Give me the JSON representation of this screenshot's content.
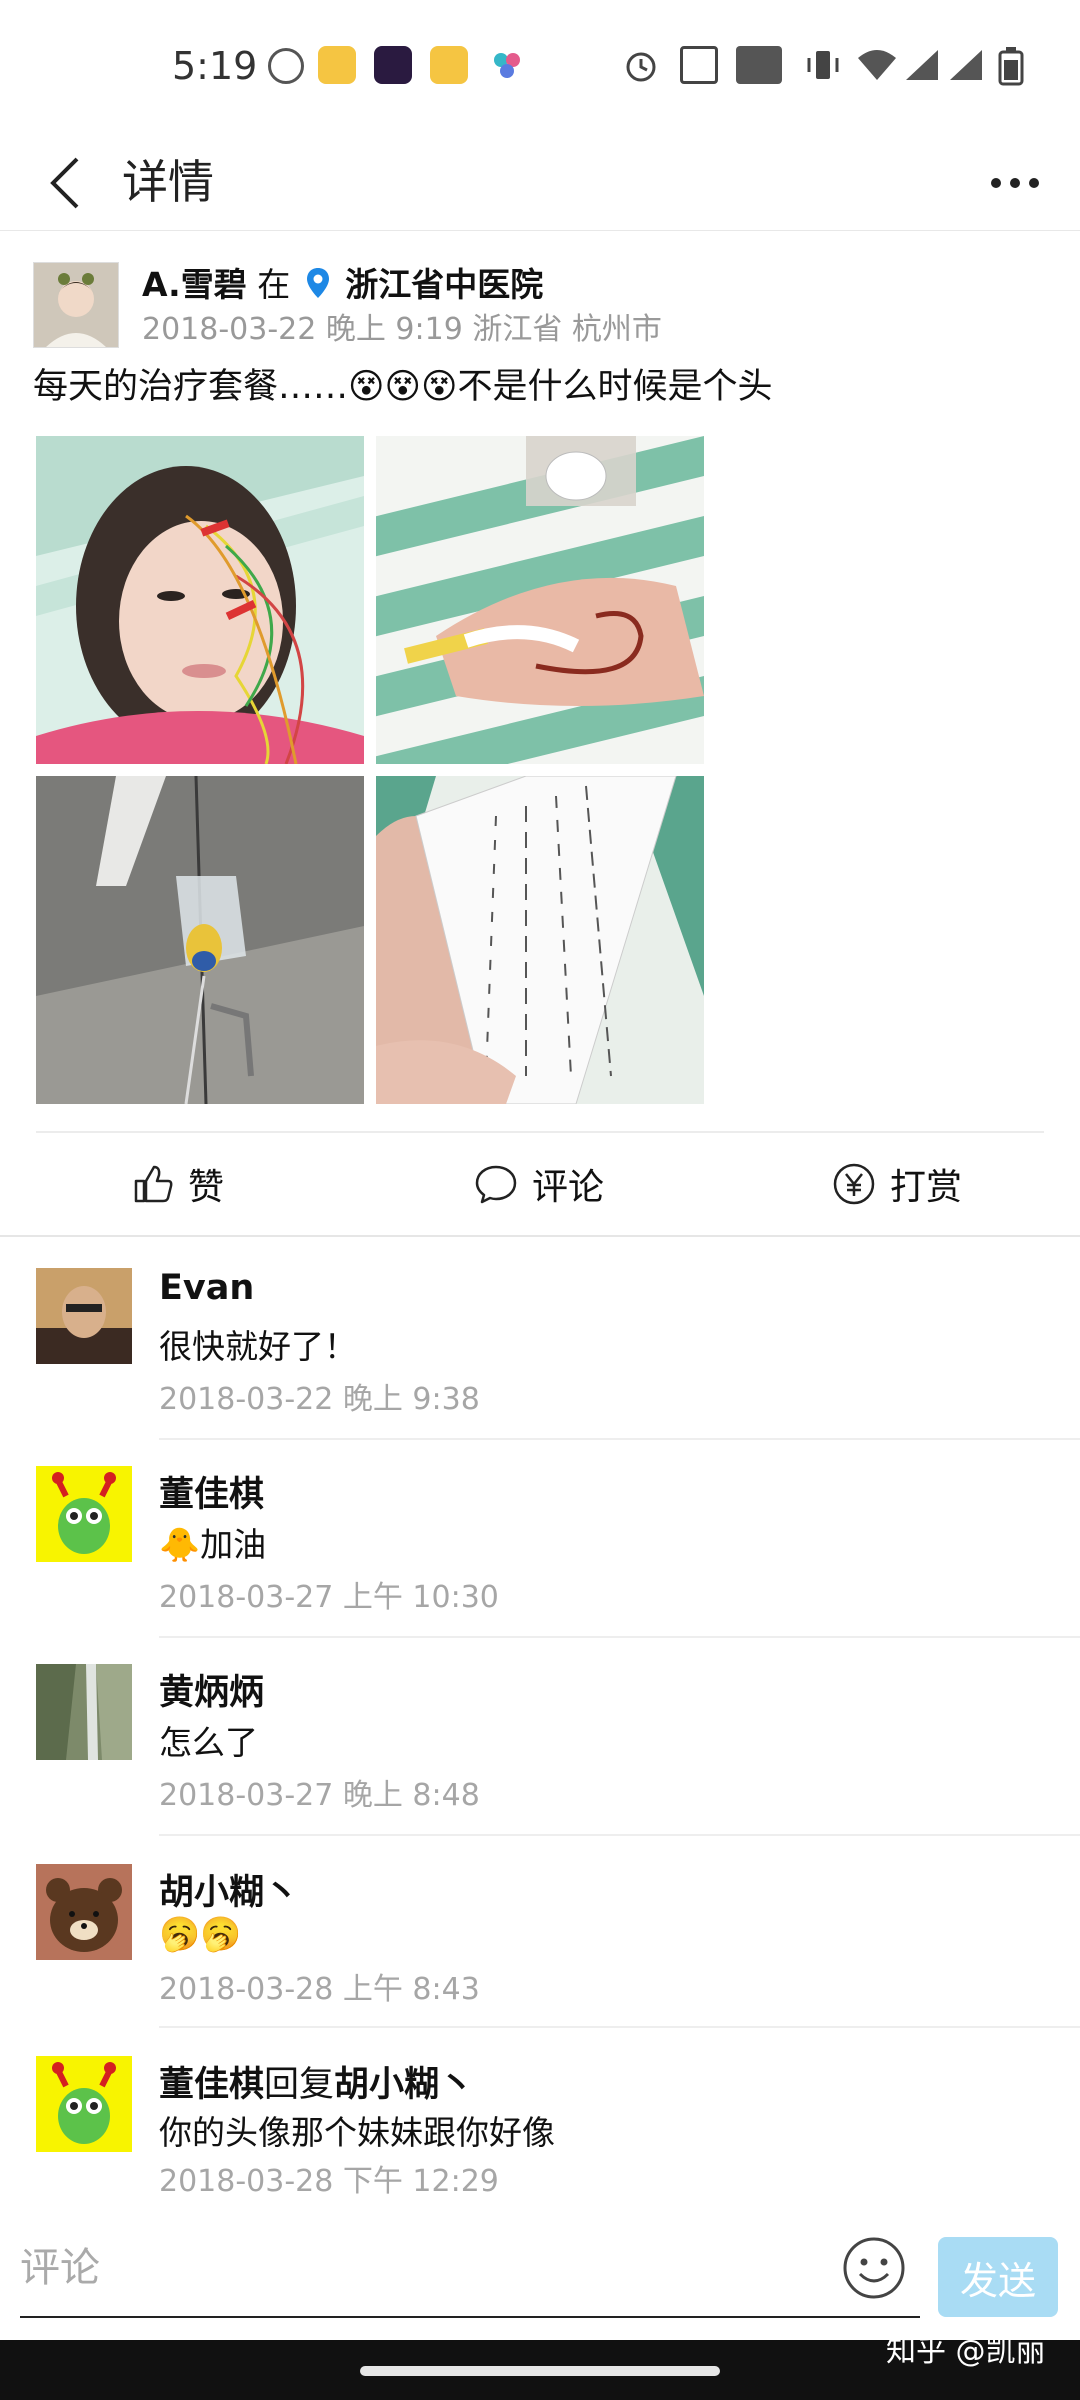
{
  "status_bar": {
    "time": "5:19",
    "icons": [
      "netease-music-icon",
      "weibo-icon",
      "video-app-icon",
      "weibo-icon",
      "clover-app-icon",
      "alarm-icon",
      "nfc-icon",
      "volte-icon",
      "vibrate-icon",
      "wifi-icon",
      "signal-icon",
      "signal-icon",
      "battery-icon"
    ]
  },
  "header": {
    "title": "详情"
  },
  "post": {
    "author": "A.雪碧",
    "at": "在",
    "location": "浙江省中医院",
    "datetime": "2018-03-22 晚上 9:19 浙江省 杭州市",
    "text": "每天的治疗套餐……😵😵😵不是什么时候是个头",
    "photos": [
      "face-acupuncture-photo",
      "hand-iv-photo",
      "iv-bag-photo",
      "wristband-photo"
    ]
  },
  "actions": {
    "like": "赞",
    "comment": "评论",
    "reward": "打赏"
  },
  "comments": [
    {
      "name": "Evan",
      "text": "很快就好了！",
      "time": "2018-03-22 晚上 9:38"
    },
    {
      "name": "董佳棋",
      "text": "🐥加油",
      "time": "2018-03-27 上午 10:30"
    },
    {
      "name": "黄炳炳",
      "text": "怎么了",
      "time": "2018-03-27 晚上 8:48"
    },
    {
      "name": "胡小糊丶",
      "text": "🥱🥱",
      "time": "2018-03-28 上午 8:43"
    },
    {
      "name": "董佳棋",
      "reply_word": "回复",
      "reply_to": "胡小糊丶",
      "text": "你的头像那个妹妹跟你好像",
      "time": "2018-03-28 下午 12:29"
    }
  ],
  "input": {
    "placeholder": "评论",
    "send_label": "发送"
  },
  "watermark": "知乎 @凯丽",
  "colors": {
    "accent_blue": "#1e88e5",
    "send_disabled": "#a9dcf4",
    "meta_gray": "#999999"
  }
}
